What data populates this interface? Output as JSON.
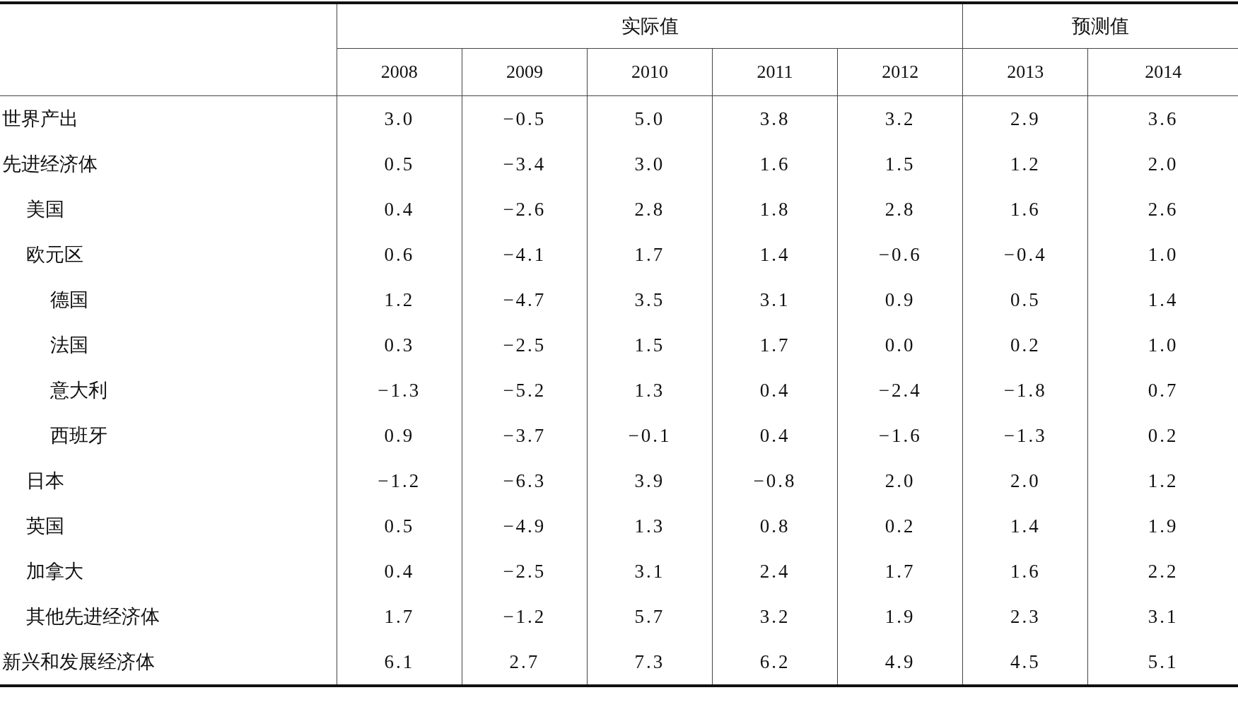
{
  "header_groups": [
    {
      "label": "实际值",
      "years": [
        "2008",
        "2009",
        "2010",
        "2011",
        "2012"
      ]
    },
    {
      "label": "预测值",
      "years": [
        "2013",
        "2014"
      ]
    }
  ],
  "rows": [
    {
      "label": "世界产出",
      "values": [
        "3.0",
        "−0.5",
        "5.0",
        "3.8",
        "3.2",
        "2.9",
        "3.6"
      ]
    },
    {
      "label": "先进经济体",
      "values": [
        "0.5",
        "−3.4",
        "3.0",
        "1.6",
        "1.5",
        "1.2",
        "2.0"
      ],
      "children": [
        {
          "label": "美国",
          "values": [
            "0.4",
            "−2.6",
            "2.8",
            "1.8",
            "2.8",
            "1.6",
            "2.6"
          ]
        },
        {
          "label": "欧元区",
          "values": [
            "0.6",
            "−4.1",
            "1.7",
            "1.4",
            "−0.6",
            "−0.4",
            "1.0"
          ],
          "children": [
            {
              "label": "德国",
              "values": [
                "1.2",
                "−4.7",
                "3.5",
                "3.1",
                "0.9",
                "0.5",
                "1.4"
              ]
            },
            {
              "label": "法国",
              "values": [
                "0.3",
                "−2.5",
                "1.5",
                "1.7",
                "0.0",
                "0.2",
                "1.0"
              ]
            },
            {
              "label": "意大利",
              "values": [
                "−1.3",
                "−5.2",
                "1.3",
                "0.4",
                "−2.4",
                "−1.8",
                "0.7"
              ]
            },
            {
              "label": "西班牙",
              "values": [
                "0.9",
                "−3.7",
                "−0.1",
                "0.4",
                "−1.6",
                "−1.3",
                "0.2"
              ]
            }
          ]
        },
        {
          "label": "日本",
          "values": [
            "−1.2",
            "−6.3",
            "3.9",
            "−0.8",
            "2.0",
            "2.0",
            "1.2"
          ]
        },
        {
          "label": "英国",
          "values": [
            "0.5",
            "−4.9",
            "1.3",
            "0.8",
            "0.2",
            "1.4",
            "1.9"
          ]
        },
        {
          "label": "加拿大",
          "values": [
            "0.4",
            "−2.5",
            "3.1",
            "2.4",
            "1.7",
            "1.6",
            "2.2"
          ]
        },
        {
          "label": "其他先进经济体",
          "values": [
            "1.7",
            "−1.2",
            "5.7",
            "3.2",
            "1.9",
            "2.3",
            "3.1"
          ]
        }
      ]
    },
    {
      "label": "新兴和发展经济体",
      "values": [
        "6.1",
        "2.7",
        "7.3",
        "6.2",
        "4.9",
        "4.5",
        "5.1"
      ]
    }
  ]
}
